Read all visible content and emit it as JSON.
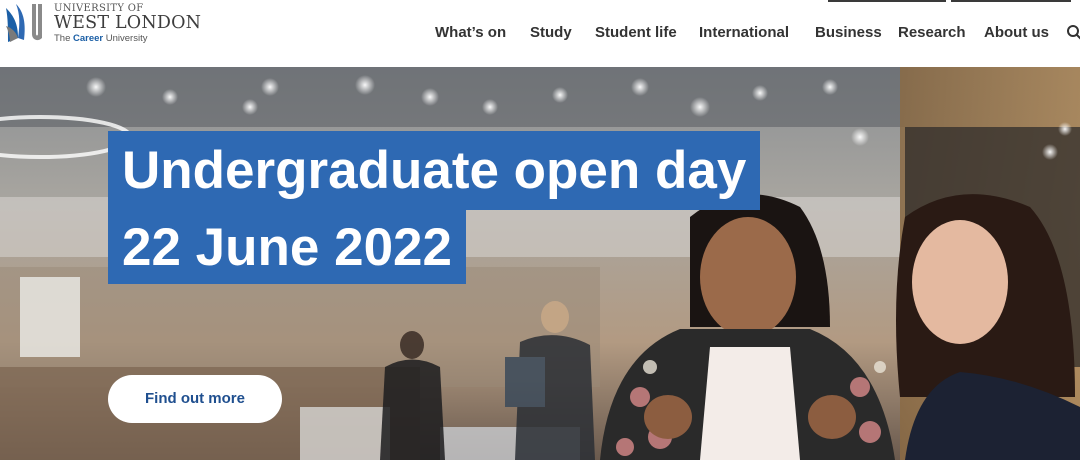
{
  "brand": {
    "line1": "UNIVERSITY OF",
    "line2": "WEST LONDON",
    "tagline_prefix": "The",
    "tagline_highlight": "Career",
    "tagline_suffix": "University",
    "colors": {
      "blue": "#1b5fa6",
      "grey": "#4a4a4a"
    }
  },
  "nav": {
    "items": [
      {
        "label": "What’s on"
      },
      {
        "label": "Study"
      },
      {
        "label": "Student life"
      },
      {
        "label": "International"
      },
      {
        "label": "Business"
      },
      {
        "label": "Research"
      },
      {
        "label": "About us"
      }
    ],
    "search_icon": "search-icon"
  },
  "hero": {
    "headline_line1": "Undergraduate open day",
    "headline_line2": "22 June 2022",
    "cta_label": "Find out more",
    "colors": {
      "headline_bg": "#2e69b3",
      "headline_text": "#ffffff",
      "cta_text": "#1f4f8f"
    }
  }
}
